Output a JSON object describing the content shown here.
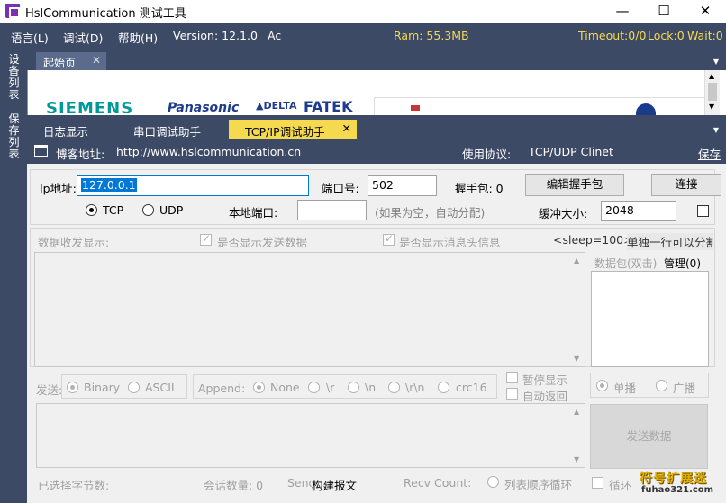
{
  "window": {
    "title": "HslCommunication 测试工具",
    "min": "—",
    "max": "☐",
    "close": "✕"
  },
  "menu": {
    "lang": "语言(L)",
    "debug": "调试(D)",
    "help": "帮助(H)",
    "version": "Version: 12.1.0",
    "ac": "Ac",
    "ram": "Ram: 55.3MB",
    "timeout": "Timeout:0/0",
    "lock": "Lock:0",
    "wait": "Wait:0"
  },
  "sidebar": {
    "devices": "设备列表",
    "saved": "保存列表"
  },
  "doc_tabs": {
    "start": "起始页",
    "close": "✕"
  },
  "logos": {
    "siemens": "SIEMENS",
    "panasonic": "Panasonic",
    "delta": "▲DELTA",
    "fatek": "FATEK"
  },
  "tabs": {
    "log": "日志显示",
    "serial": "串口调试助手",
    "tcp": "TCP/IP调试助手",
    "close": "✕"
  },
  "info": {
    "blog_label": "博客地址:",
    "blog_url": "http://www.hslcommunication.cn",
    "protocol_label": "使用协议:",
    "protocol_value": "TCP/UDP Clinet",
    "save": "保存"
  },
  "conn": {
    "ip_label": "Ip地址:",
    "ip_value": "127.0.0.1",
    "port_label": "端口号:",
    "port_value": "502",
    "handshake_label": "握手包: 0",
    "edit_handshake": "编辑握手包",
    "connect": "连接",
    "tcp": "TCP",
    "udp": "UDP",
    "local_port_label": "本地端口:",
    "local_port_value": "",
    "local_port_hint": "(如果为空，自动分配)",
    "buffer_label": "缓冲大小:",
    "buffer_value": "2048"
  },
  "data_area": {
    "recv_label": "数据收发显示:",
    "show_send": "是否显示发送数据",
    "show_header": "是否显示消息头信息",
    "sleep": "<sleep=100>",
    "single_line": "单独一行可以分割",
    "packet_label": "数据包(双击)",
    "manage": "管理(0)"
  },
  "send_opts": {
    "send_label": "发送:",
    "binary": "Binary",
    "ascii": "ASCII",
    "append_label": "Append:",
    "none": "None",
    "r": "\\r",
    "n": "\\n",
    "rn": "\\r\\n",
    "crc16": "crc16",
    "pause": "暂停显示",
    "auto_return": "自动返回",
    "unicast": "单播",
    "broadcast": "广播",
    "send_button": "发送数据"
  },
  "status": {
    "selected_bytes": "已选择字节数:",
    "session_count": "会话数量: 0",
    "send": "Send",
    "build": "构建报文",
    "recv": "Recv Count:",
    "list_loop": "列表顺序循环",
    "loop": "循环"
  },
  "watermark": {
    "line1": "符号扩展迷",
    "line2": "fuhao321.com"
  }
}
